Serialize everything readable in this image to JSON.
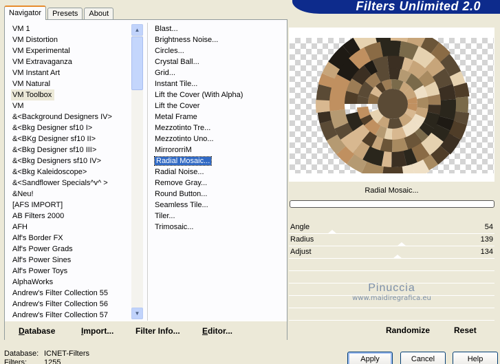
{
  "banner": {
    "title": "Filters Unlimited 2.0"
  },
  "tabs": [
    {
      "label": "Navigator",
      "active": true
    },
    {
      "label": "Presets",
      "active": false
    },
    {
      "label": "About",
      "active": false
    }
  ],
  "categories": {
    "selected": "VM Toolbox",
    "items": [
      "VM 1",
      "VM Distortion",
      "VM Experimental",
      "VM Extravaganza",
      "VM Instant Art",
      "VM Natural",
      "VM Toolbox",
      "VM",
      "&<Background Designers IV>",
      "&<Bkg Designer sf10 I>",
      "&<BKg Designer sf10 II>",
      "&<Bkg Designer sf10 III>",
      "&<Bkg Designers sf10 IV>",
      "&<Bkg Kaleidoscope>",
      "&<Sandflower Specials^v^ >",
      "&Neu!",
      "[AFS IMPORT]",
      "AB Filters 2000",
      "AFH",
      "Alf's Border FX",
      "Alf's Power Grads",
      "Alf's Power Sines",
      "Alf's Power Toys",
      "AlphaWorks",
      "Andrew's Filter Collection 55",
      "Andrew's Filter Collection 56",
      "Andrew's Filter Collection 57"
    ]
  },
  "filters": {
    "selected": "Radial Mosaic...",
    "items": [
      "Blast...",
      "Brightness Noise...",
      "Circles...",
      "Crystal Ball...",
      "Grid...",
      "Instant Tile...",
      "Lift the Cover (With Alpha)",
      "Lift the Cover",
      "Metal Frame",
      "Mezzotinto Tre...",
      "Mezzotinto Uno...",
      "MirrororriM",
      "Radial Mosaic...",
      "Radial Noise...",
      "Remove Gray...",
      "Round Button...",
      "Seamless Tile...",
      "Tiler...",
      "Trimosaic..."
    ]
  },
  "left_buttons": {
    "database": "Database",
    "import": "Import...",
    "filter_info": "Filter Info...",
    "editor": "Editor..."
  },
  "preview": {
    "filter_name": "Radial Mosaic...",
    "progress": 0
  },
  "params": [
    {
      "name": "Angle",
      "value": "54",
      "slider": 0.21
    },
    {
      "name": "Radius",
      "value": "139",
      "slider": 0.55
    },
    {
      "name": "Adjust",
      "value": "134",
      "slider": 0.53
    }
  ],
  "watermark": {
    "line1": "Pinuccia",
    "line2": "www.maidiregrafica.eu"
  },
  "right_buttons": {
    "randomize": "Randomize",
    "reset": "Reset"
  },
  "status": {
    "database_label": "Database:",
    "database_value": "ICNET-Filters",
    "filters_label": "Filters:",
    "filters_value": "1255"
  },
  "dialog_buttons": {
    "apply": "Apply",
    "cancel": "Cancel",
    "help": "Help"
  },
  "colors": {
    "banner": "#0d2b8c",
    "selection": "#316ac5",
    "tab_accent": "#e68b2c"
  }
}
